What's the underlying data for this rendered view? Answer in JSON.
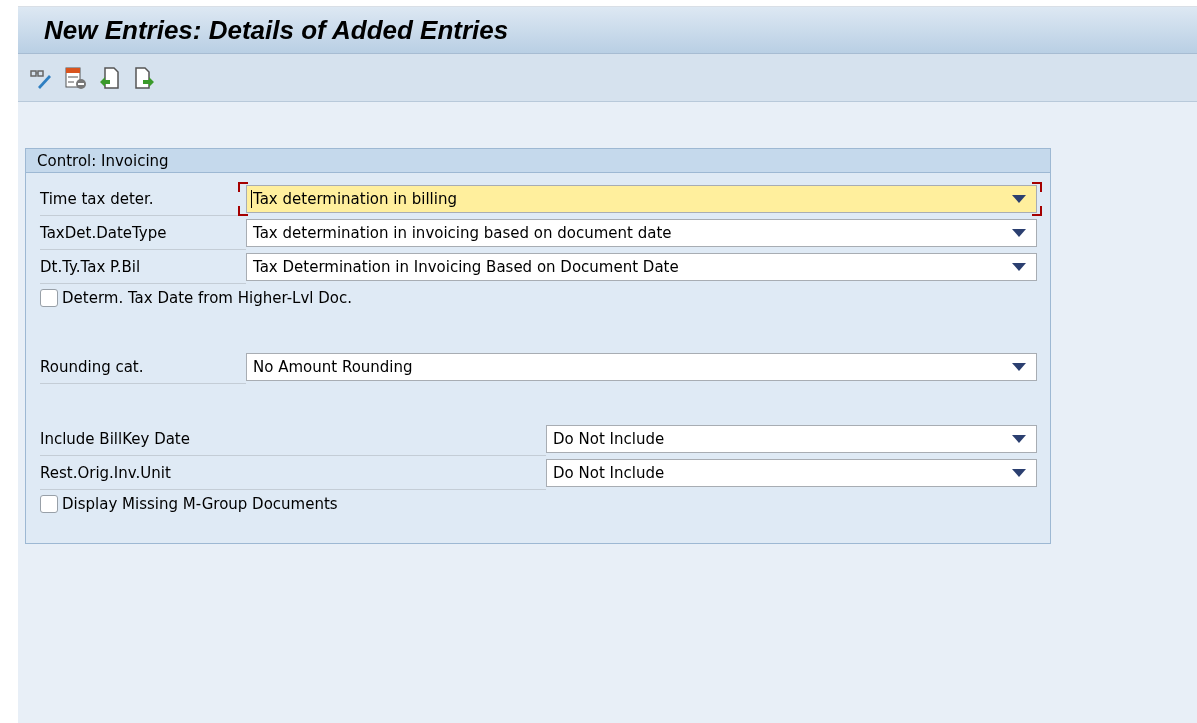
{
  "window": {
    "title": "New Entries: Details of Added Entries"
  },
  "group": {
    "title": "Control: Invoicing",
    "sections": [
      {
        "rows": [
          {
            "kind": "dropdown",
            "label": "Time tax deter.",
            "value": "Tax determination in billing",
            "focused": true
          },
          {
            "kind": "dropdown",
            "label": "TaxDet.DateType",
            "value": "Tax determination in invoicing based on document date",
            "focused": false
          },
          {
            "kind": "dropdown",
            "label": "Dt.Ty.Tax P.Bil",
            "value": "Tax Determination in Invoicing Based on Document Date",
            "focused": false
          },
          {
            "kind": "checkbox",
            "label": "Determ. Tax Date from Higher-Lvl Doc.",
            "checked": false
          }
        ]
      },
      {
        "rows": [
          {
            "kind": "dropdown",
            "label": "Rounding cat.",
            "value": "No Amount Rounding",
            "focused": false
          }
        ]
      },
      {
        "rows": [
          {
            "kind": "short-dropdown",
            "label": "Include BillKey Date",
            "value": "Do Not Include",
            "focused": false
          },
          {
            "kind": "short-dropdown",
            "label": "Rest.Orig.Inv.Unit",
            "value": "Do Not Include",
            "focused": false
          },
          {
            "kind": "checkbox",
            "label": "Display Missing M-Group Documents",
            "checked": false
          }
        ]
      }
    ]
  }
}
